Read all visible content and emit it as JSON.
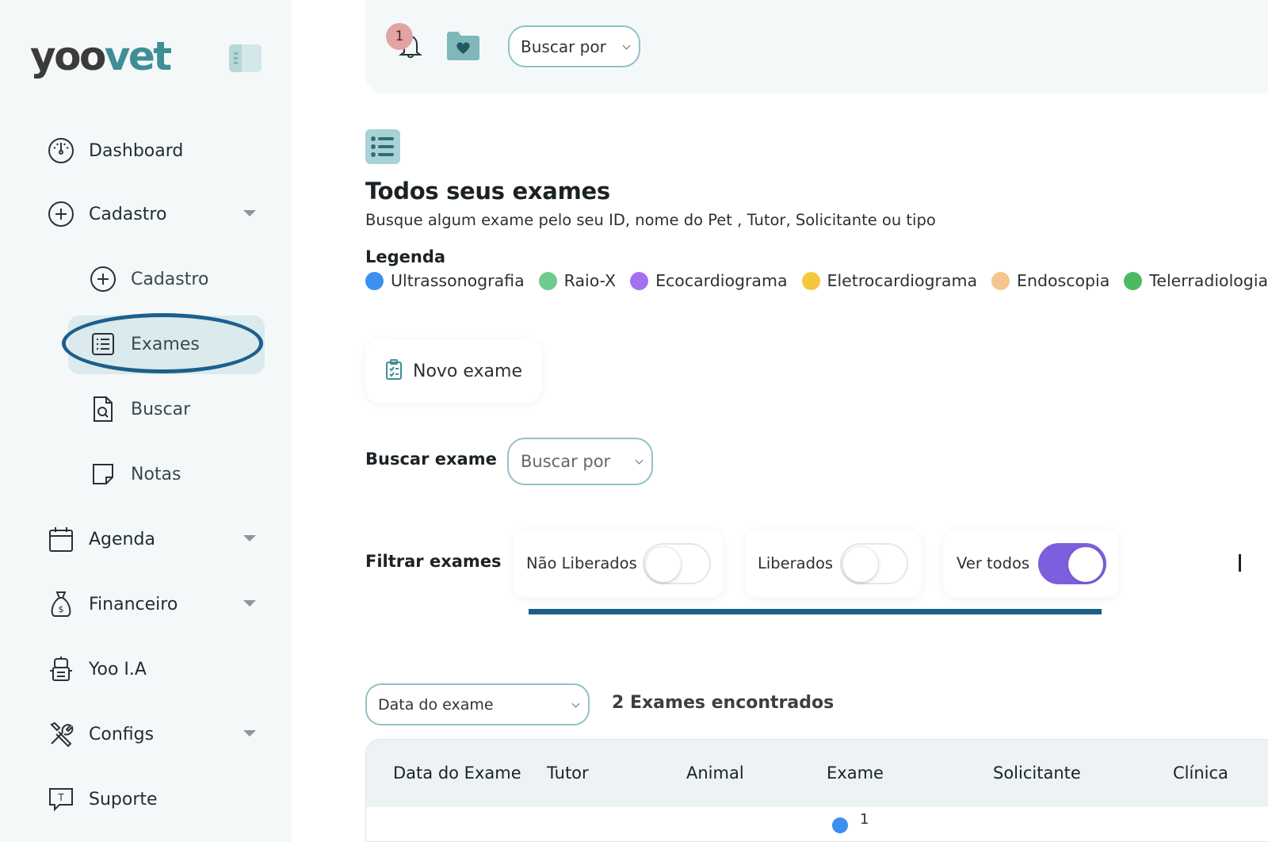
{
  "app": {
    "logo_part1": "yoo",
    "logo_part2": "vet",
    "colors": {
      "accent": "#3e8f95",
      "highlight": "#1c5f8c",
      "toggle_on": "#7c5fdc"
    }
  },
  "sidebar": {
    "items": [
      {
        "label": "Dashboard",
        "icon": "dashboard-gauge-icon"
      },
      {
        "label": "Cadastro",
        "icon": "plus-circle-icon",
        "expandable": true
      },
      {
        "label": "Cadastro",
        "icon": "plus-circle-icon",
        "sub": true
      },
      {
        "label": "Exames",
        "icon": "list-icon",
        "sub": true,
        "active": true
      },
      {
        "label": "Buscar",
        "icon": "search-document-icon",
        "sub": true
      },
      {
        "label": "Notas",
        "icon": "note-icon",
        "sub": true
      },
      {
        "label": "Agenda",
        "icon": "calendar-icon",
        "expandable": true
      },
      {
        "label": "Financeiro",
        "icon": "money-bag-icon",
        "expandable": true
      },
      {
        "label": "Yoo I.A",
        "icon": "robot-icon"
      },
      {
        "label": "Configs",
        "icon": "tools-icon",
        "expandable": true
      },
      {
        "label": "Suporte",
        "icon": "support-chat-icon"
      }
    ]
  },
  "topbar": {
    "notification_count": "1",
    "search_select": "Buscar por"
  },
  "main": {
    "title": "Todos seus exames",
    "subtitle": "Busque algum exame pelo seu ID, nome do Pet , Tutor, Solicitante ou tipo",
    "legend_title": "Legenda",
    "legend": [
      {
        "label": "Ultrassonografia",
        "color": "#3b8ff0"
      },
      {
        "label": "Raio-X",
        "color": "#6fcb8c"
      },
      {
        "label": "Ecocardiograma",
        "color": "#a66ff0"
      },
      {
        "label": "Eletrocardiograma",
        "color": "#f5c83c"
      },
      {
        "label": "Endoscopia",
        "color": "#f5c58c"
      },
      {
        "label": "Telerradiologia",
        "color": "#4cb964"
      }
    ],
    "new_exam_label": "Novo exame",
    "search_label": "Buscar exame",
    "search_select": "Buscar por",
    "filter_label": "Filtrar exames",
    "filters": [
      {
        "label": "Não Liberados",
        "on": false
      },
      {
        "label": "Liberados",
        "on": false
      },
      {
        "label": "Ver todos",
        "on": true
      }
    ],
    "sort_select": "Data do exame",
    "results_count": "2 Exames encontrados",
    "table": {
      "columns": [
        "Data do Exame",
        "Tutor",
        "Animal",
        "Exame",
        "Solicitante",
        "Clínica"
      ],
      "first_row_partial": "1"
    }
  }
}
